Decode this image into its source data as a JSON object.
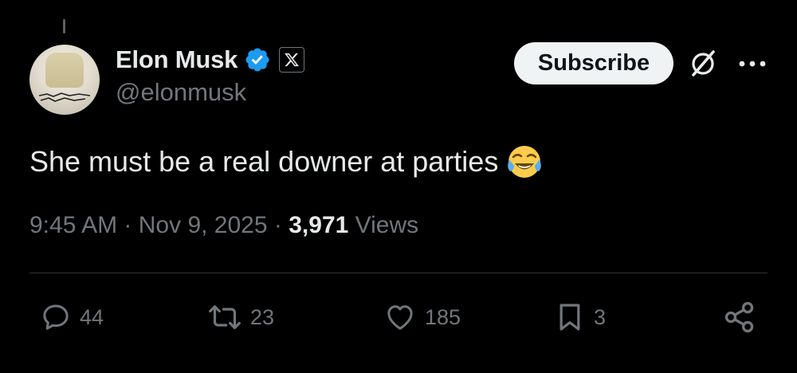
{
  "author": {
    "display_name": "Elon Musk",
    "handle": "@elonmusk",
    "verified_color": "#1d9bf0"
  },
  "header": {
    "subscribe_label": "Subscribe"
  },
  "tweet": {
    "text": "She must be a real downer at parties",
    "emoji": "face-with-tears-of-joy",
    "time": "9:45 AM",
    "separator": "·",
    "date": "Nov 9, 2025",
    "views_count": "3,971",
    "views_label": "Views"
  },
  "actions": {
    "replies": "44",
    "reposts": "23",
    "likes": "185",
    "bookmarks": "3"
  },
  "colors": {
    "background": "#000000",
    "text_primary": "#e7e9ea",
    "text_secondary": "#71767b",
    "divider": "#2f3336",
    "button_bg": "#eff3f4"
  }
}
